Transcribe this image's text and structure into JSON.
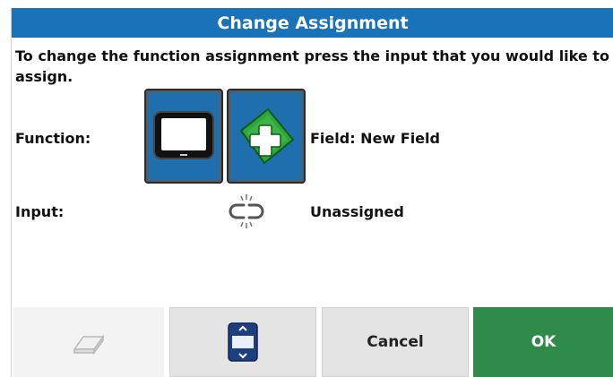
{
  "dialog": {
    "title": "Change Assignment",
    "instruction": "To change the function assignment press the input that you would like to assign."
  },
  "function_row": {
    "label": "Function:",
    "icons": [
      "display-icon",
      "new-field-icon"
    ],
    "value": "Field: New Field"
  },
  "input_row": {
    "label": "Input:",
    "icon": "broken-link-icon",
    "value": "Unassigned"
  },
  "buttons": {
    "erase_icon": "eraser-icon",
    "scroll_icon": "scroll-list-icon",
    "cancel_label": "Cancel",
    "ok_label": "OK"
  },
  "colors": {
    "title_bar": "#1a72b8",
    "tile": "#1f6fae",
    "ok": "#2e8b4a",
    "new_field_green": "#2fa63a"
  }
}
